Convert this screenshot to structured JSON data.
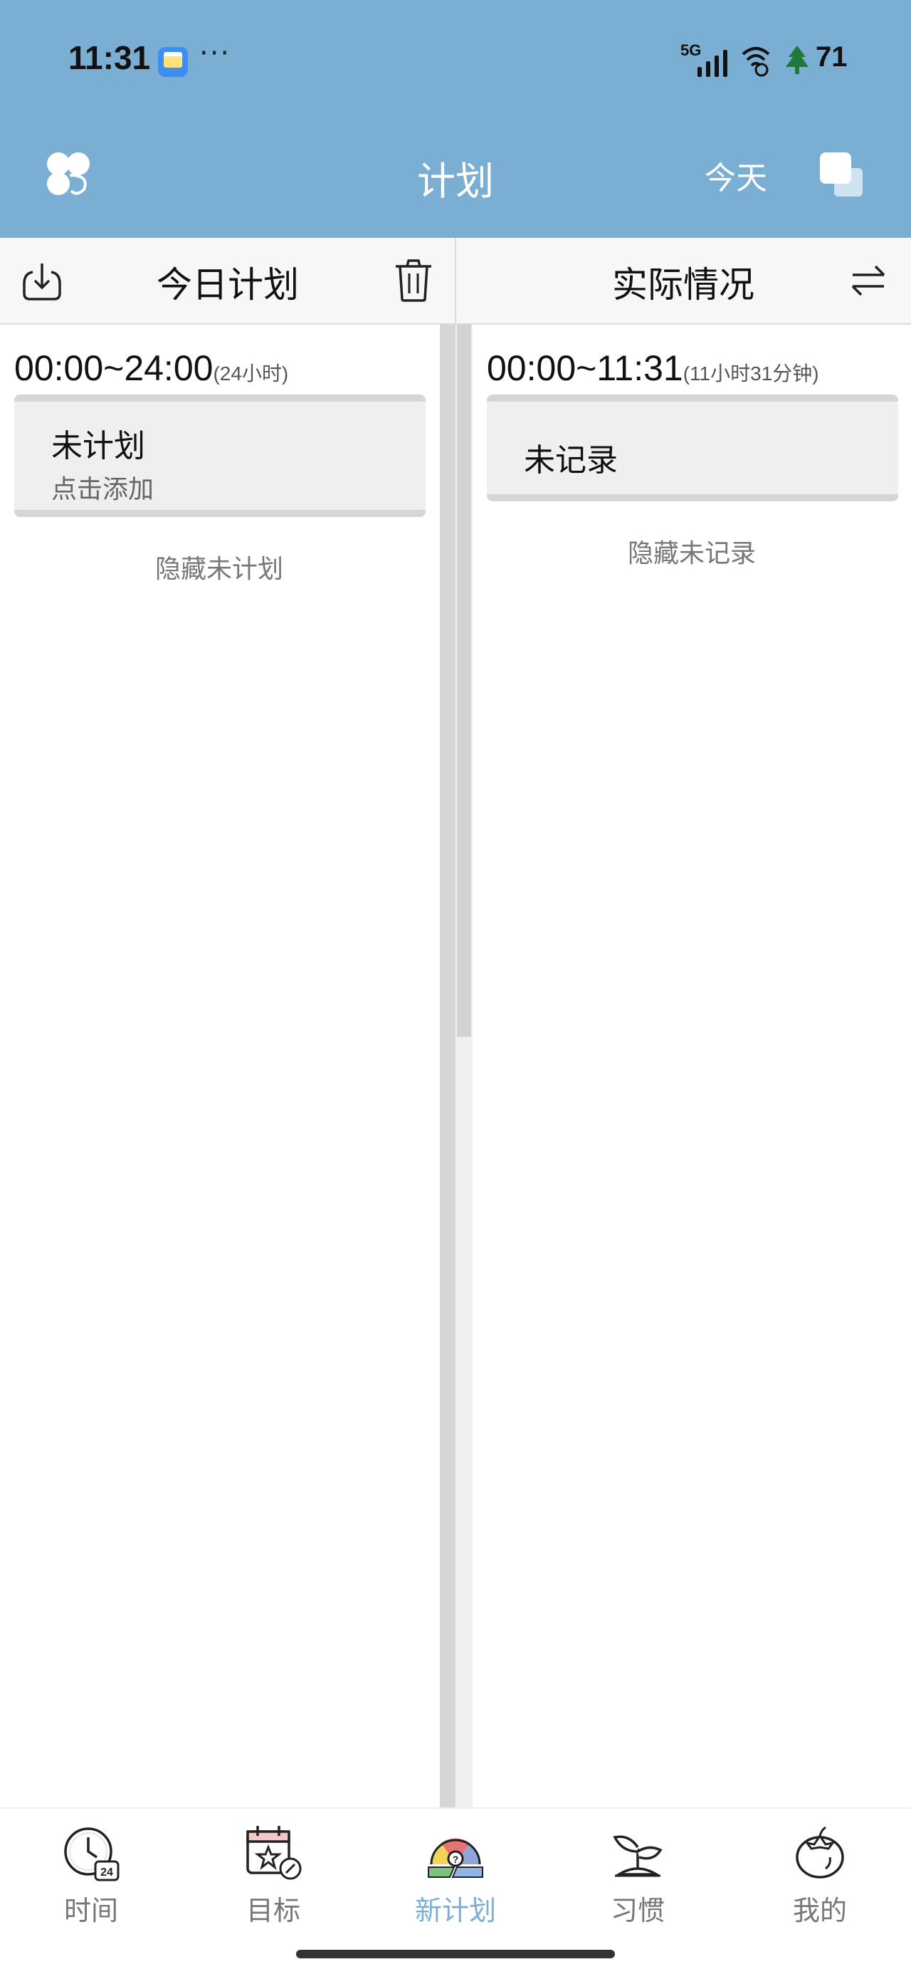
{
  "status_bar": {
    "time": "11:31",
    "more": "···",
    "network": "5G",
    "battery": "71"
  },
  "header": {
    "title": "计划",
    "today_label": "今天"
  },
  "columns": {
    "plan": {
      "title": "今日计划",
      "range": "00:00~24:00",
      "duration": "(24小时)",
      "card_title": "未计划",
      "card_hint": "点击添加",
      "hide_label": "隐藏未计划"
    },
    "actual": {
      "title": "实际情况",
      "range": "00:00~11:31",
      "duration": "(11小时31分钟)",
      "card_title": "未记录",
      "hide_label": "隐藏未记录"
    }
  },
  "bottom_nav": {
    "active_index": 2,
    "items": [
      {
        "label": "时间",
        "icon": "clock-24-icon"
      },
      {
        "label": "目标",
        "icon": "calendar-star-icon"
      },
      {
        "label": "新计划",
        "icon": "gauge-icon"
      },
      {
        "label": "习惯",
        "icon": "sprout-icon"
      },
      {
        "label": "我的",
        "icon": "tomato-icon"
      }
    ]
  },
  "colors": {
    "header_bg": "#7aafd3",
    "active_tab": "#7aafd3"
  }
}
